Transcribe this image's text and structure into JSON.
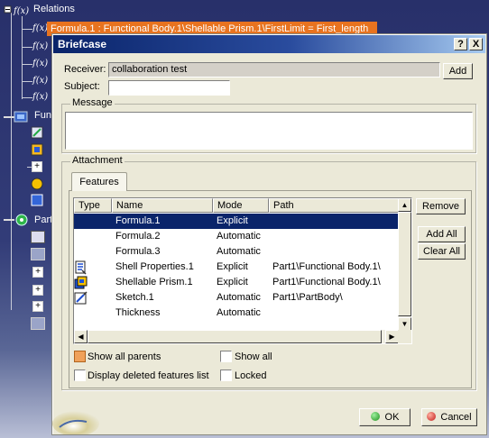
{
  "background": {
    "tree_root": "Relations",
    "highlighted_formula": "Formula.1 : Functional Body.1\\Shellable Prism.1\\FirstLimit = First_length",
    "fx_items": [
      "fx F",
      "fx F",
      "fx F",
      "fx F"
    ],
    "tree_labels": [
      "Func",
      "Part"
    ]
  },
  "dialog": {
    "title": "Briefcase",
    "help_button": "?",
    "close_button": "X",
    "receiver_label": "Receiver:",
    "receiver_value": "collaboration test",
    "add_button": "Add",
    "subject_label": "Subject:",
    "subject_value": "",
    "message_label": "Message",
    "message_value": "",
    "attachment_label": "Attachment",
    "features_tab": "Features",
    "columns": [
      "Type",
      "Name",
      "Mode",
      "Path"
    ],
    "rows": [
      {
        "icon": "none",
        "name": "Formula.1",
        "mode": "Explicit",
        "path": "",
        "selected": true
      },
      {
        "icon": "none",
        "name": "Formula.2",
        "mode": "Automatic",
        "path": "",
        "selected": false
      },
      {
        "icon": "none",
        "name": "Formula.3",
        "mode": "Automatic",
        "path": "",
        "selected": false
      },
      {
        "icon": "shell-properties-icon",
        "name": "Shell Properties.1",
        "mode": "Explicit",
        "path": "Part1\\Functional Body.1\\",
        "selected": false
      },
      {
        "icon": "shellable-prism-icon",
        "name": "Shellable Prism.1",
        "mode": "Explicit",
        "path": "Part1\\Functional Body.1\\",
        "selected": false
      },
      {
        "icon": "sketch-icon",
        "name": "Sketch.1",
        "mode": "Automatic",
        "path": "Part1\\PartBody\\",
        "selected": false
      },
      {
        "icon": "none",
        "name": "Thickness",
        "mode": "Automatic",
        "path": "",
        "selected": false
      }
    ],
    "remove_button": "Remove",
    "add_all_button": "Add All",
    "clear_all_button": "Clear All",
    "show_all_parents": {
      "label": "Show all parents",
      "checked": true
    },
    "show_all": {
      "label": "Show all",
      "checked": false
    },
    "display_deleted": {
      "label": "Display deleted features list",
      "checked": false
    },
    "locked": {
      "label": "Locked",
      "checked": false
    },
    "ok_button": "OK",
    "cancel_button": "Cancel"
  },
  "colors": {
    "selection": "#0a246a",
    "titlebar_start": "#0a246a",
    "titlebar_end": "#a6caf0",
    "highlight": "#e8731f",
    "dialog_bg": "#ebe9d8"
  }
}
